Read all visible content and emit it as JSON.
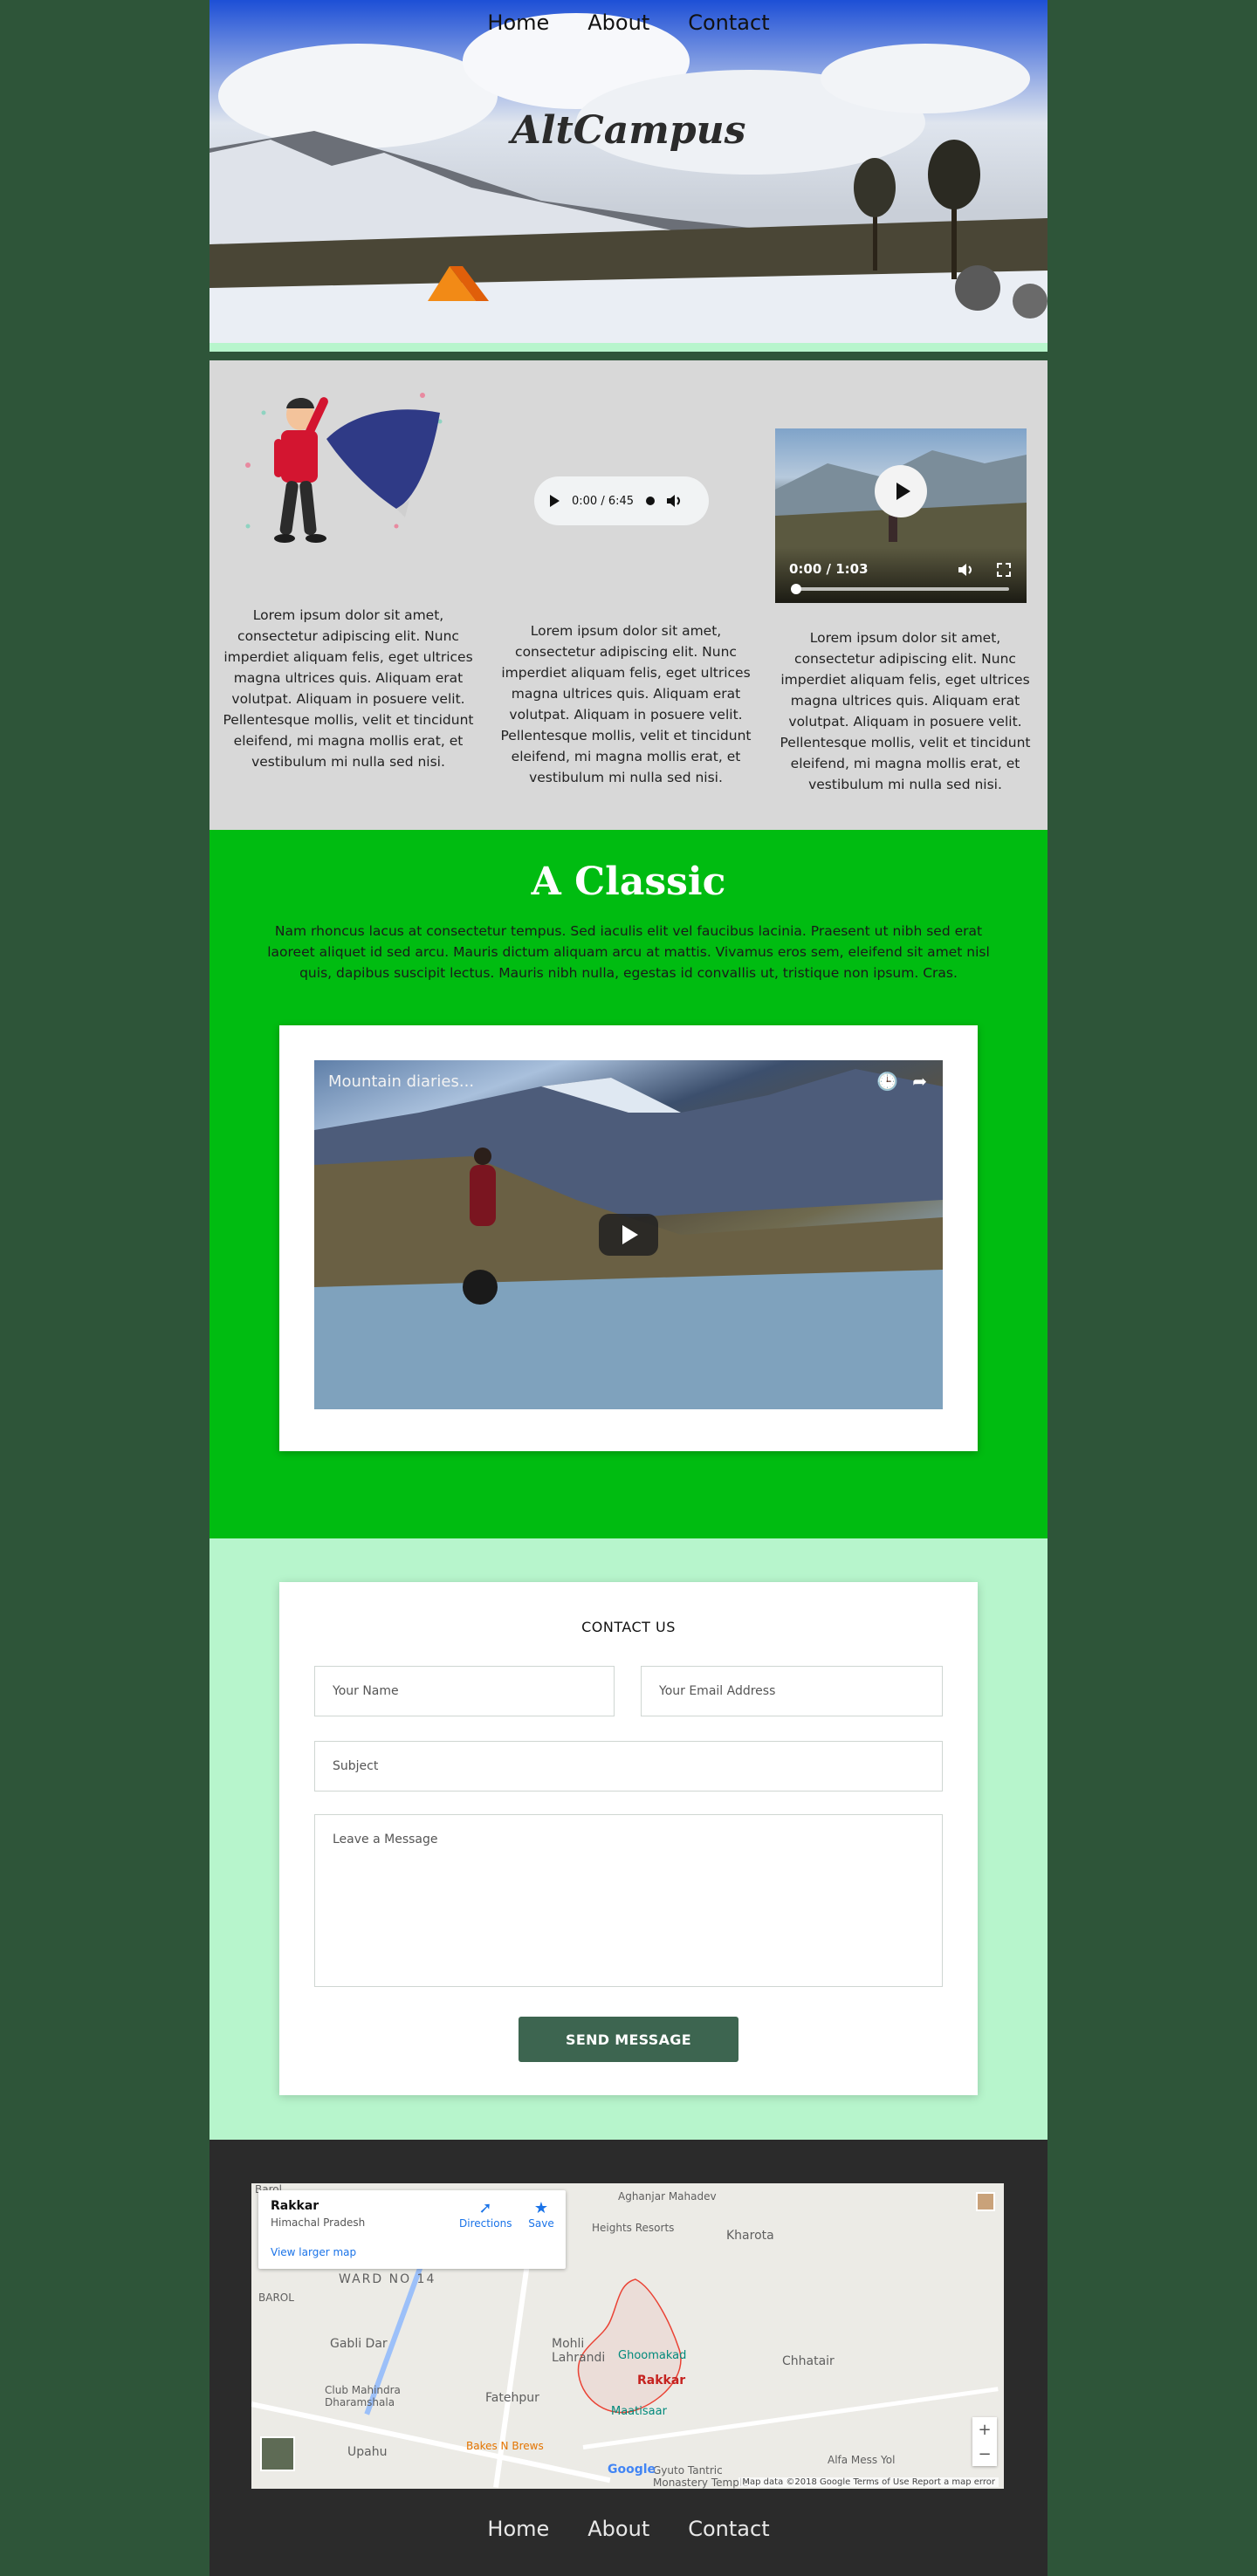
{
  "nav": {
    "items": [
      "Home",
      "About",
      "Contact"
    ]
  },
  "hero": {
    "title": "AltCampus"
  },
  "features": {
    "audio_time": "0:00 / 6:45",
    "video_time": "0:00 / 1:03",
    "col1_text": "Lorem ipsum dolor sit amet, consectetur adipiscing elit. Nunc imperdiet aliquam felis, eget ultrices magna ultrices quis. Aliquam erat volutpat. Aliquam in posuere velit. Pellentesque mollis, velit et tincidunt eleifend, mi magna mollis erat, et vestibulum mi nulla sed nisi.",
    "col2_text": "Lorem ipsum dolor sit amet, consectetur adipiscing elit. Nunc imperdiet aliquam felis, eget ultrices magna ultrices quis. Aliquam erat volutpat. Aliquam in posuere velit. Pellentesque mollis, velit et tincidunt eleifend, mi magna mollis erat, et vestibulum mi nulla sed nisi.",
    "col3_text": "Lorem ipsum dolor sit amet, consectetur adipiscing elit. Nunc imperdiet aliquam felis, eget ultrices magna ultrices quis. Aliquam erat volutpat. Aliquam in posuere velit. Pellentesque mollis, velit et tincidunt eleifend, mi magna mollis erat, et vestibulum mi nulla sed nisi."
  },
  "classic": {
    "title": "A Classic",
    "lead": "Nam rhoncus lacus at consectetur tempus. Sed iaculis elit vel faucibus lacinia. Praesent ut nibh sed erat laoreet aliquet id sed arcu. Mauris dictum aliquam arcu at mattis. Vivamus eros sem, eleifend sit amet nisl quis, dapibus suscipit lectus. Mauris nibh nulla, egestas id convallis ut, tristique non ipsum. Cras.",
    "video_title": "Mountain diaries..."
  },
  "contact": {
    "heading": "CONTACT US",
    "name_placeholder": "Your Name",
    "email_placeholder": "Your Email Address",
    "subject_placeholder": "Subject",
    "message_placeholder": "Leave a Message",
    "send_label": "SEND MESSAGE"
  },
  "map": {
    "place": "Rakkar",
    "region": "Himachal Pradesh",
    "larger": "View larger map",
    "directions": "Directions",
    "save": "Save",
    "attribution": "Map data ©2018 Google   Terms of Use   Report a map error",
    "logo": "Google",
    "labels": {
      "barol_top": "Barol",
      "aghanjar": "Aghanjar Mahadev",
      "heights": "Heights Resorts",
      "kharota": "Kharota",
      "ward": "WARD NO 14",
      "barol": "BAROL",
      "gabli": "Gabli Dar",
      "mohli": "Mohli Lahrandi",
      "ghoomakad": "Ghoomakad",
      "rakkar": "Rakkar",
      "maatisaar": "Maatisaar",
      "chhatair": "Chhatair",
      "club": "Club Mahindra Dharamshala",
      "fatehpur": "Fatehpur",
      "upahu": "Upahu",
      "bakes": "Bakes N Brews",
      "alfa": "Alfa Mess Yol",
      "gyuto": "Gyuto Tantric Monastery Temple"
    }
  },
  "footer_nav": {
    "items": [
      "Home",
      "About",
      "Contact"
    ]
  },
  "colors": {
    "page_bg": "#2e5539",
    "features_bg": "#d8d8d8",
    "classic_bg": "#00bc11",
    "contact_bg": "#b7f5cc",
    "footer_bg": "#2b2b2b",
    "button_bg": "#3d6550"
  }
}
